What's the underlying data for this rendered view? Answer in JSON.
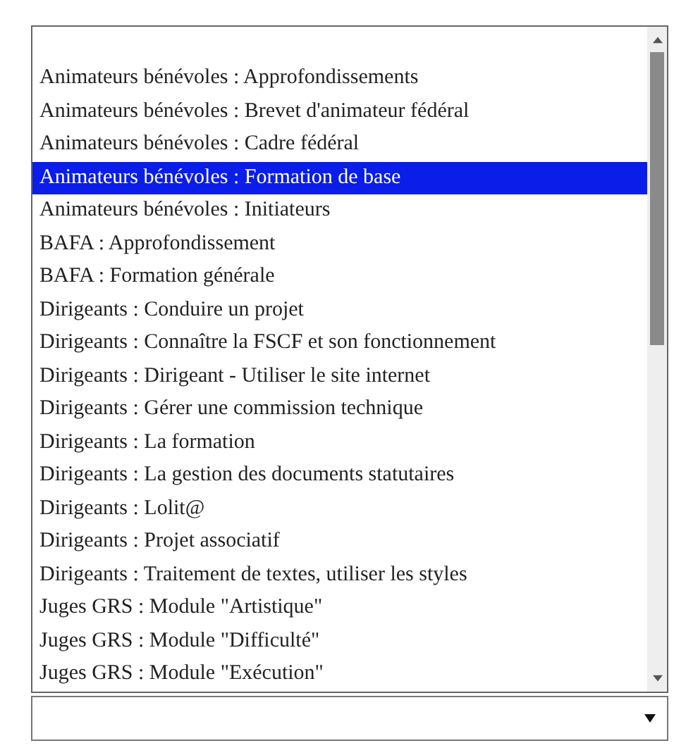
{
  "dropdown": {
    "options": [
      {
        "label": "Animateurs bénévoles : Approfondissements",
        "selected": false
      },
      {
        "label": "Animateurs bénévoles : Brevet d'animateur fédéral",
        "selected": false
      },
      {
        "label": "Animateurs bénévoles : Cadre fédéral",
        "selected": false
      },
      {
        "label": "Animateurs bénévoles : Formation de base",
        "selected": true
      },
      {
        "label": "Animateurs bénévoles : Initiateurs",
        "selected": false
      },
      {
        "label": "BAFA : Approfondissement",
        "selected": false
      },
      {
        "label": "BAFA : Formation générale",
        "selected": false
      },
      {
        "label": "Dirigeants : Conduire un projet",
        "selected": false
      },
      {
        "label": "Dirigeants : Connaître la FSCF et son fonctionnement",
        "selected": false
      },
      {
        "label": "Dirigeants : Dirigeant - Utiliser le site internet",
        "selected": false
      },
      {
        "label": "Dirigeants : Gérer une commission technique",
        "selected": false
      },
      {
        "label": "Dirigeants : La formation",
        "selected": false
      },
      {
        "label": "Dirigeants : La gestion des documents statutaires",
        "selected": false
      },
      {
        "label": "Dirigeants : Lolit@",
        "selected": false
      },
      {
        "label": "Dirigeants : Projet associatif",
        "selected": false
      },
      {
        "label": "Dirigeants : Traitement de textes, utiliser les styles",
        "selected": false
      },
      {
        "label": "Juges GRS : Module \"Artistique\"",
        "selected": false
      },
      {
        "label": "Juges GRS : Module \"Difficulté\"",
        "selected": false
      },
      {
        "label": "Juges GRS : Module \"Exécution\"",
        "selected": false
      }
    ]
  }
}
